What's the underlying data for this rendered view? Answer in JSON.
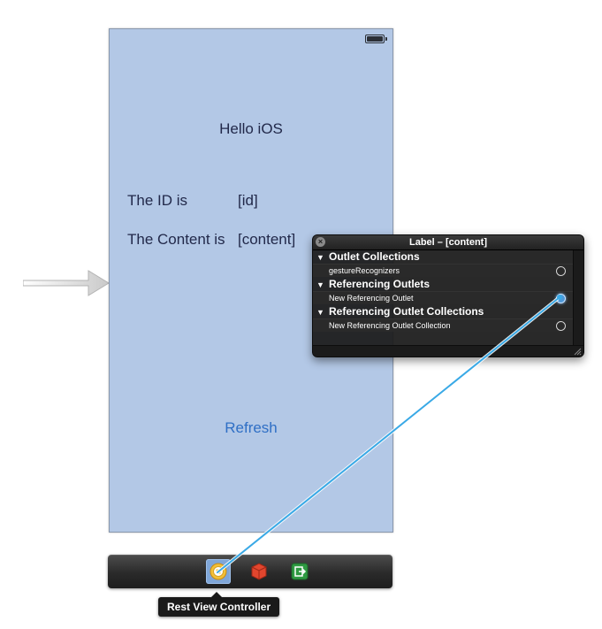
{
  "scene": {
    "title_label": "Hello iOS",
    "id_caption": "The ID is",
    "id_value": "[id]",
    "content_caption": "The Content is",
    "content_value": "[content]",
    "refresh_button": "Refresh"
  },
  "dock": {
    "tooltip": "Rest View Controller",
    "items": [
      "view-controller-icon",
      "first-responder-icon",
      "exit-icon"
    ]
  },
  "connections_hud": {
    "title": "Label – [content]",
    "sections": [
      {
        "title": "Outlet Collections",
        "rows": [
          "gestureRecognizers"
        ]
      },
      {
        "title": "Referencing Outlets",
        "rows": [
          "New Referencing Outlet"
        ]
      },
      {
        "title": "Referencing Outlet Collections",
        "rows": [
          "New Referencing Outlet Collection"
        ]
      }
    ]
  },
  "colors": {
    "scene_background": "#b3c8e6",
    "accent": "#2f6fc5",
    "connection_line": "#39a9e6"
  }
}
